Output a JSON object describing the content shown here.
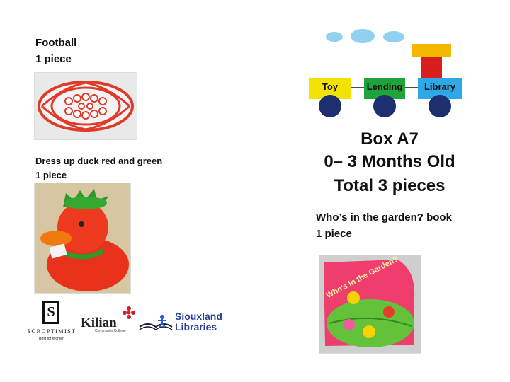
{
  "items": [
    {
      "title": "Football",
      "qty": "1 piece"
    },
    {
      "title": "Dress up duck red and green",
      "qty": "1 piece"
    },
    {
      "title": "Who’s in the garden? book",
      "qty": "1 piece"
    }
  ],
  "box": {
    "name": "Box A7",
    "age": "0– 3 Months Old",
    "total": "Total 3 pieces"
  },
  "train": {
    "cars": [
      "Toy",
      "Lending",
      "Library"
    ],
    "colors": {
      "yellow": "#f2e400",
      "green": "#1fa33a",
      "blue": "#2ea8e6",
      "wheel": "#1d2f6f",
      "chimney_top": "#f4b700",
      "chimney": "#d81e1e",
      "cloud": "#8fd1ef"
    }
  },
  "book_cover_text": "Who's in the Garden?",
  "sponsors": {
    "soroptimist": {
      "name": "SOROPTIMIST",
      "tagline": "Best for Women",
      "emblem": "S"
    },
    "kilian": {
      "name": "Kilian",
      "sub": "Community College"
    },
    "siouxland": {
      "line1": "Siouxland",
      "line2": "Libraries"
    }
  }
}
